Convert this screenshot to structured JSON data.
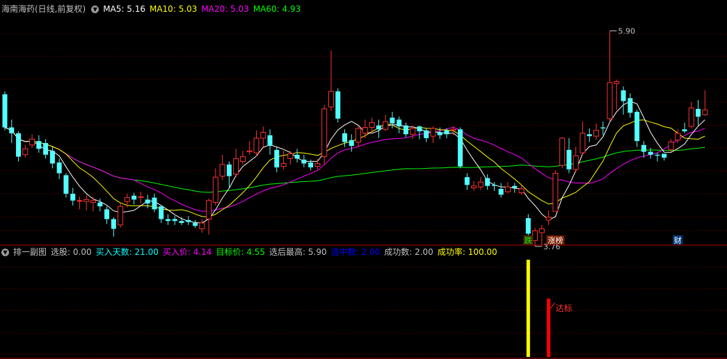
{
  "header": {
    "stock_title": "海南海药(日线,前复权)",
    "indicators": [
      {
        "label": "MA5:",
        "value": "5.16",
        "color": "#ffffff"
      },
      {
        "label": "MA10:",
        "value": "5.03",
        "color": "#ffff00"
      },
      {
        "label": "MA20:",
        "value": "5.03",
        "color": "#ff00ff"
      },
      {
        "label": "MA60:",
        "value": "4.93",
        "color": "#00ff00"
      }
    ]
  },
  "sub_header": {
    "name": "排一副图",
    "fields": [
      {
        "label": "选股:",
        "value": "0.00",
        "color": "#c0c0c0"
      },
      {
        "label": "买入天数:",
        "value": "21.00",
        "color": "#00ffff"
      },
      {
        "label": "买入价:",
        "value": "4.14",
        "color": "#ff00ff"
      },
      {
        "label": "目标价:",
        "value": "4.55",
        "color": "#00ff00"
      },
      {
        "label": "选后最高:",
        "value": "5.90",
        "color": "#c0c0c0"
      },
      {
        "label": "选中数:",
        "value": "2.00",
        "color": "#0000ff"
      },
      {
        "label": "成功数:",
        "value": "2.00",
        "color": "#c0c0c0"
      },
      {
        "label": "成功率:",
        "value": "100.00",
        "color": "#ffff00"
      }
    ]
  },
  "annotations": {
    "high_label": "5.90",
    "low_label": "3.76",
    "tag_die": "跌",
    "tag_zhangbang": "涨榜",
    "tag_cai": "财",
    "reached_label": "达标"
  },
  "colors": {
    "up": "#ff3232",
    "down": "#54ffff",
    "ma5": "#ffffff",
    "ma10": "#ffff00",
    "ma20": "#ff00ff",
    "ma60": "#00ff00",
    "grid": "#800000"
  },
  "chart_data": {
    "type": "candlestick",
    "y_range": [
      3.7,
      6.05
    ],
    "candles": [
      [
        5.24,
        4.9,
        5.27,
        4.87
      ],
      [
        4.9,
        4.84,
        4.98,
        4.74
      ],
      [
        4.84,
        4.6,
        4.86,
        4.55
      ],
      [
        4.62,
        4.68,
        4.72,
        4.59
      ],
      [
        4.72,
        4.78,
        4.83,
        4.69
      ],
      [
        4.76,
        4.68,
        4.82,
        4.64
      ],
      [
        4.74,
        4.62,
        4.78,
        4.58
      ],
      [
        4.66,
        4.53,
        4.7,
        4.48
      ],
      [
        4.54,
        4.43,
        4.58,
        4.37
      ],
      [
        4.41,
        4.22,
        4.43,
        4.18
      ],
      [
        4.22,
        4.15,
        4.28,
        4.1
      ],
      [
        4.15,
        4.15,
        4.19,
        4.06
      ],
      [
        4.14,
        4.16,
        4.21,
        4.05
      ],
      [
        4.13,
        4.15,
        4.19,
        4.04
      ],
      [
        4.13,
        4.09,
        4.17,
        4.04
      ],
      [
        4.06,
        3.96,
        4.09,
        3.91
      ],
      [
        3.96,
        3.86,
        3.98,
        3.78
      ],
      [
        3.9,
        4.09,
        4.12,
        3.87
      ],
      [
        4.14,
        4.18,
        4.22,
        4.08
      ],
      [
        4.2,
        4.16,
        4.23,
        4.11
      ],
      [
        4.18,
        4.19,
        4.24,
        4.12
      ],
      [
        4.16,
        4.12,
        4.21,
        4.07
      ],
      [
        4.18,
        4.06,
        4.22,
        4.03
      ],
      [
        4.09,
        3.96,
        4.1,
        3.92
      ],
      [
        3.96,
        3.94,
        4.01,
        3.9
      ],
      [
        3.96,
        3.94,
        3.99,
        3.9
      ],
      [
        3.94,
        3.92,
        3.98,
        3.9
      ],
      [
        3.95,
        3.93,
        3.99,
        3.9
      ],
      [
        3.92,
        3.89,
        3.95,
        3.87
      ],
      [
        3.86,
        3.92,
        3.96,
        3.82
      ],
      [
        3.96,
        4.15,
        4.17,
        3.8
      ],
      [
        4.13,
        4.39,
        4.48,
        4.1
      ],
      [
        4.4,
        4.52,
        4.62,
        4.36
      ],
      [
        4.52,
        4.4,
        4.55,
        4.28
      ],
      [
        4.42,
        4.58,
        4.68,
        4.39
      ],
      [
        4.55,
        4.6,
        4.66,
        4.52
      ],
      [
        4.65,
        4.66,
        4.76,
        4.62
      ],
      [
        4.64,
        4.79,
        4.87,
        4.6
      ],
      [
        4.79,
        4.85,
        4.91,
        4.7
      ],
      [
        4.82,
        4.71,
        4.88,
        4.62
      ],
      [
        4.67,
        4.49,
        4.7,
        4.44
      ],
      [
        4.5,
        4.53,
        4.66,
        4.47
      ],
      [
        4.58,
        4.63,
        4.66,
        4.52
      ],
      [
        4.62,
        4.58,
        4.68,
        4.54
      ],
      [
        4.57,
        4.53,
        4.62,
        4.49
      ],
      [
        4.54,
        4.49,
        4.57,
        4.46
      ],
      [
        4.5,
        4.53,
        4.58,
        4.47
      ],
      [
        4.6,
        5.09,
        5.13,
        4.52
      ],
      [
        5.11,
        5.27,
        5.69,
        5.07
      ],
      [
        5.27,
        4.99,
        5.3,
        4.95
      ],
      [
        4.84,
        4.75,
        4.88,
        4.7
      ],
      [
        4.77,
        4.71,
        4.83,
        4.65
      ],
      [
        4.75,
        4.89,
        4.92,
        4.7
      ],
      [
        4.84,
        4.9,
        4.98,
        4.79
      ],
      [
        4.9,
        4.95,
        5.0,
        4.84
      ],
      [
        4.92,
        4.88,
        4.98,
        4.79
      ],
      [
        4.88,
        4.96,
        5.03,
        4.86
      ],
      [
        5.0,
        4.94,
        5.06,
        4.89
      ],
      [
        4.98,
        4.91,
        5.01,
        4.84
      ],
      [
        4.92,
        4.83,
        4.95,
        4.8
      ],
      [
        4.83,
        4.89,
        4.92,
        4.78
      ],
      [
        4.91,
        4.86,
        4.92,
        4.78
      ],
      [
        4.87,
        4.79,
        4.89,
        4.75
      ],
      [
        4.81,
        4.89,
        4.91,
        4.74
      ],
      [
        4.85,
        4.82,
        4.9,
        4.78
      ],
      [
        4.87,
        4.83,
        4.89,
        4.79
      ],
      [
        4.87,
        4.88,
        4.91,
        4.82
      ],
      [
        4.88,
        4.5,
        4.9,
        4.48
      ],
      [
        4.39,
        4.31,
        4.43,
        4.26
      ],
      [
        4.28,
        4.3,
        4.35,
        4.25
      ],
      [
        4.29,
        4.34,
        4.39,
        4.26
      ],
      [
        4.38,
        4.3,
        4.42,
        4.26
      ],
      [
        4.31,
        4.3,
        4.34,
        4.25
      ],
      [
        4.27,
        4.21,
        4.33,
        4.18
      ],
      [
        4.24,
        4.29,
        4.34,
        4.23
      ],
      [
        4.3,
        4.28,
        4.33,
        4.23
      ],
      [
        4.23,
        4.27,
        4.31,
        4.21
      ],
      [
        3.97,
        3.81,
        4.01,
        3.76
      ],
      [
        3.74,
        3.84,
        3.87,
        3.68
      ],
      [
        3.82,
        3.86,
        3.9,
        3.69
      ],
      [
        3.95,
        3.98,
        4.05,
        3.9
      ],
      [
        4.04,
        4.43,
        4.46,
        4.04
      ],
      [
        4.51,
        4.79,
        4.8,
        4.48
      ],
      [
        4.67,
        4.47,
        4.79,
        4.43
      ],
      [
        4.47,
        4.61,
        4.7,
        4.45
      ],
      [
        4.64,
        4.84,
        4.96,
        4.62
      ],
      [
        4.83,
        4.81,
        4.89,
        4.75
      ],
      [
        4.81,
        4.87,
        4.94,
        4.77
      ],
      [
        4.9,
        4.89,
        4.96,
        4.82
      ],
      [
        4.99,
        5.36,
        5.89,
        4.96
      ],
      [
        5.35,
        5.37,
        5.39,
        5.08
      ],
      [
        5.28,
        5.17,
        5.32,
        5.03
      ],
      [
        5.2,
        5.05,
        5.25,
        5.0
      ],
      [
        5.06,
        4.76,
        5.08,
        4.7
      ],
      [
        4.72,
        4.65,
        4.76,
        4.59
      ],
      [
        4.65,
        4.62,
        4.69,
        4.58
      ],
      [
        4.62,
        4.61,
        4.64,
        4.55
      ],
      [
        4.63,
        4.59,
        4.63,
        4.56
      ],
      [
        4.67,
        4.75,
        4.78,
        4.65
      ],
      [
        4.77,
        4.84,
        4.88,
        4.74
      ],
      [
        4.88,
        4.86,
        4.95,
        4.84
      ],
      [
        4.91,
        5.1,
        5.16,
        4.89
      ],
      [
        5.09,
        5.01,
        5.18,
        4.92
      ],
      [
        5.03,
        5.08,
        5.28,
        5.02
      ]
    ],
    "sub_bars": [
      {
        "index": 77,
        "value": 1.0,
        "color": "#ffff00"
      },
      {
        "index": 80,
        "value": 0.6,
        "color": "#ff0000"
      }
    ]
  }
}
